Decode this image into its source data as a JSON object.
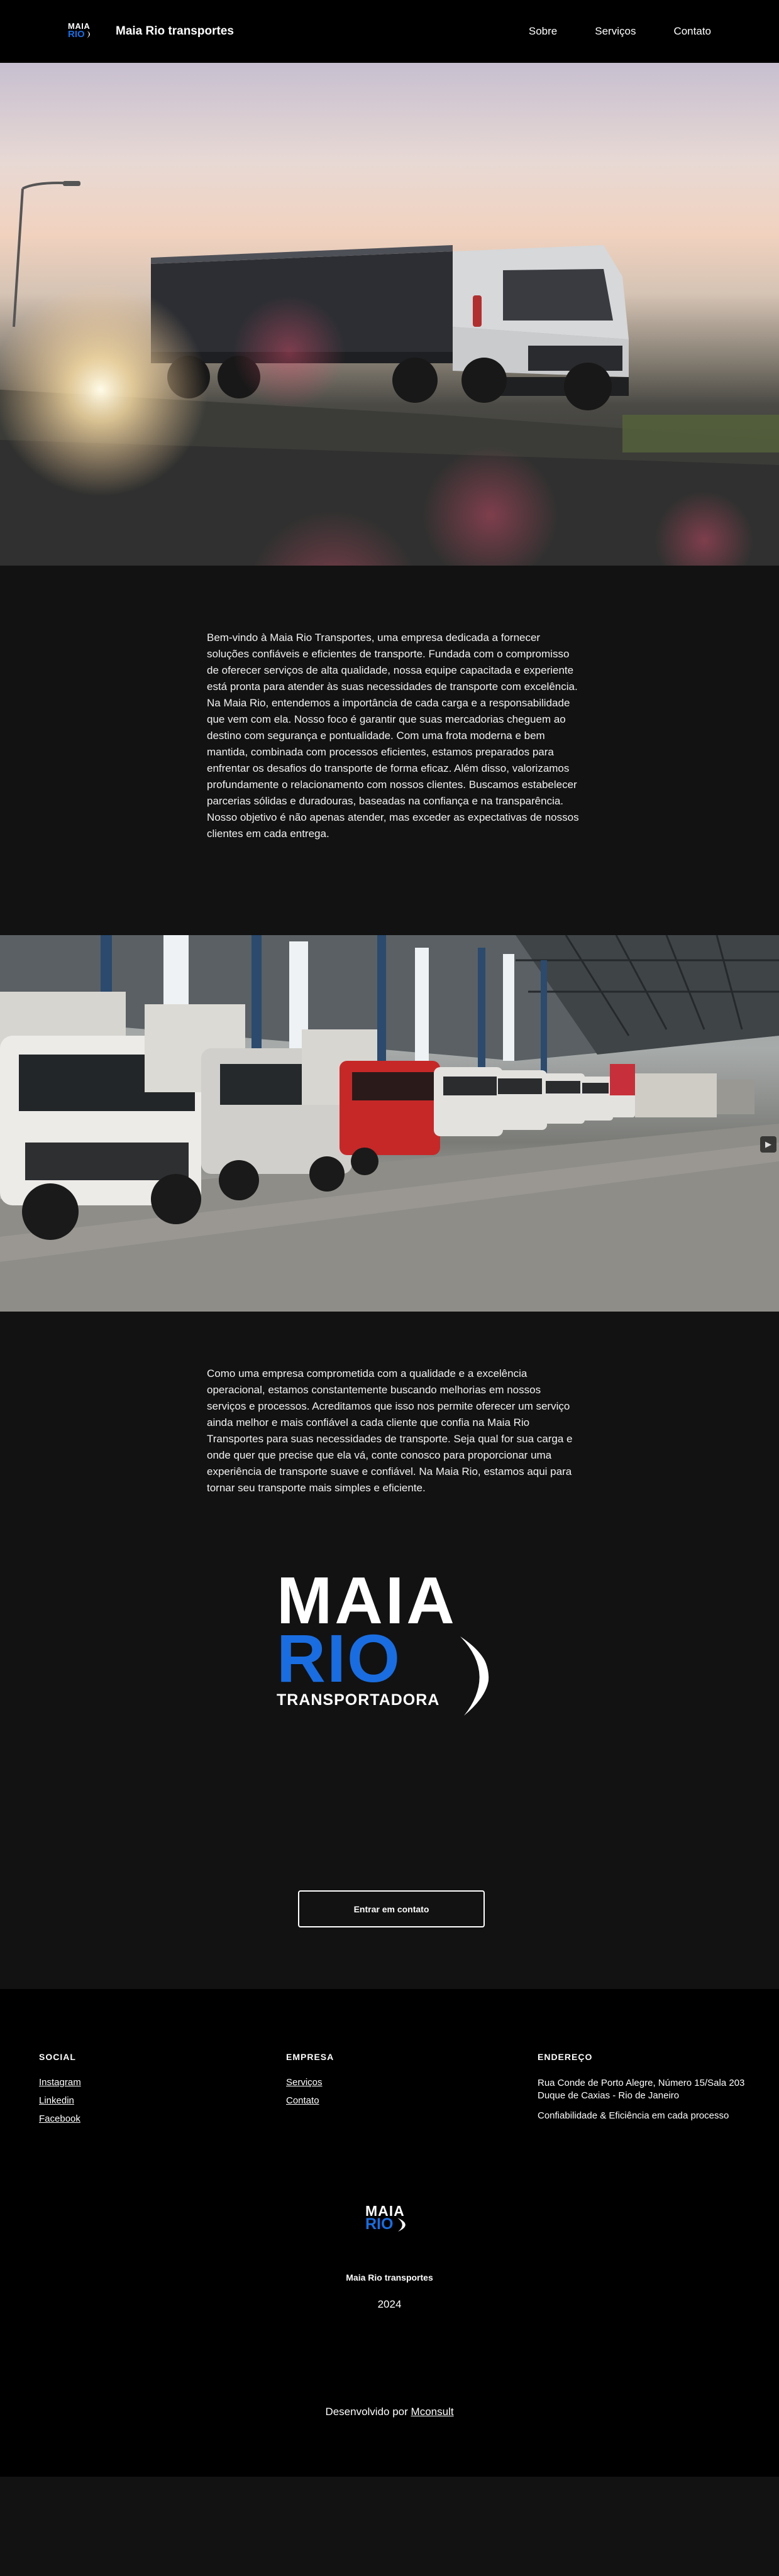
{
  "header": {
    "logo": {
      "top": "MAIA",
      "bottom": "RIO"
    },
    "brand_name": "Maia Rio transportes",
    "nav": [
      "Sobre",
      "Serviços",
      "Contato"
    ]
  },
  "about": {
    "paragraph1": "Bem-vindo à Maia Rio Transportes, uma empresa dedicada a fornecer soluções confiáveis e eficientes de transporte. Fundada com o compromisso de oferecer serviços de alta qualidade, nossa equipe capacitada e experiente está pronta para atender às suas necessidades de transporte com excelência. Na Maia Rio, entendemos a importância de cada carga e a responsabilidade que vem com ela. Nosso foco é garantir que suas mercadorias cheguem ao destino com segurança e pontualidade. Com uma frota moderna e bem mantida, combinada com processos eficientes, estamos preparados para enfrentar os desafios do transporte de forma eficaz. Além disso, valorizamos profundamente o relacionamento com nossos clientes. Buscamos estabelecer parcerias sólidas e duradouras, baseadas na confiança e na transparência. Nosso objetivo é não apenas atender, mas exceder as expectativas de nossos clientes em cada entrega.",
    "paragraph2": "Como uma empresa comprometida com a qualidade e a excelência operacional, estamos constantemente buscando melhorias em nossos serviços e processos. Acreditamos que isso nos permite oferecer um serviço ainda melhor e mais confiável a cada cliente que confia na Maia Rio Transportes para suas necessidades de transporte. Seja qual for sua carga e onde quer que precise que ela vá, conte conosco para proporcionar uma experiência de transporte suave e confiável. Na Maia Rio, estamos aqui para tornar seu transporte mais simples e eficiente."
  },
  "big_logo": {
    "line1": "MAIA",
    "line2": "RIO",
    "line3": "TRANSPORTADORA"
  },
  "cta": {
    "label": "Entrar em contato"
  },
  "footer": {
    "social": {
      "title": "SOCIAL",
      "links": [
        "Instagram",
        "Linkedin",
        "Facebook"
      ]
    },
    "empresa": {
      "title": "EMPRESA",
      "links": [
        "Serviços",
        "Contato"
      ]
    },
    "endereco": {
      "title": "ENDEREÇO",
      "line1": "Rua Conde de Porto Alegre, Número 15/Sala 203 Duque de Caxias - Rio de Janeiro",
      "line2": "Confiabilidade & Eficiência em cada processo"
    },
    "brand": "Maia Rio transportes",
    "year": "2024",
    "dev_prefix": "Desenvolvido por",
    "dev_link": "Mconsult"
  },
  "colors": {
    "accent_blue": "#1a6de0",
    "background": "#121212",
    "footer_bg": "#000000"
  }
}
